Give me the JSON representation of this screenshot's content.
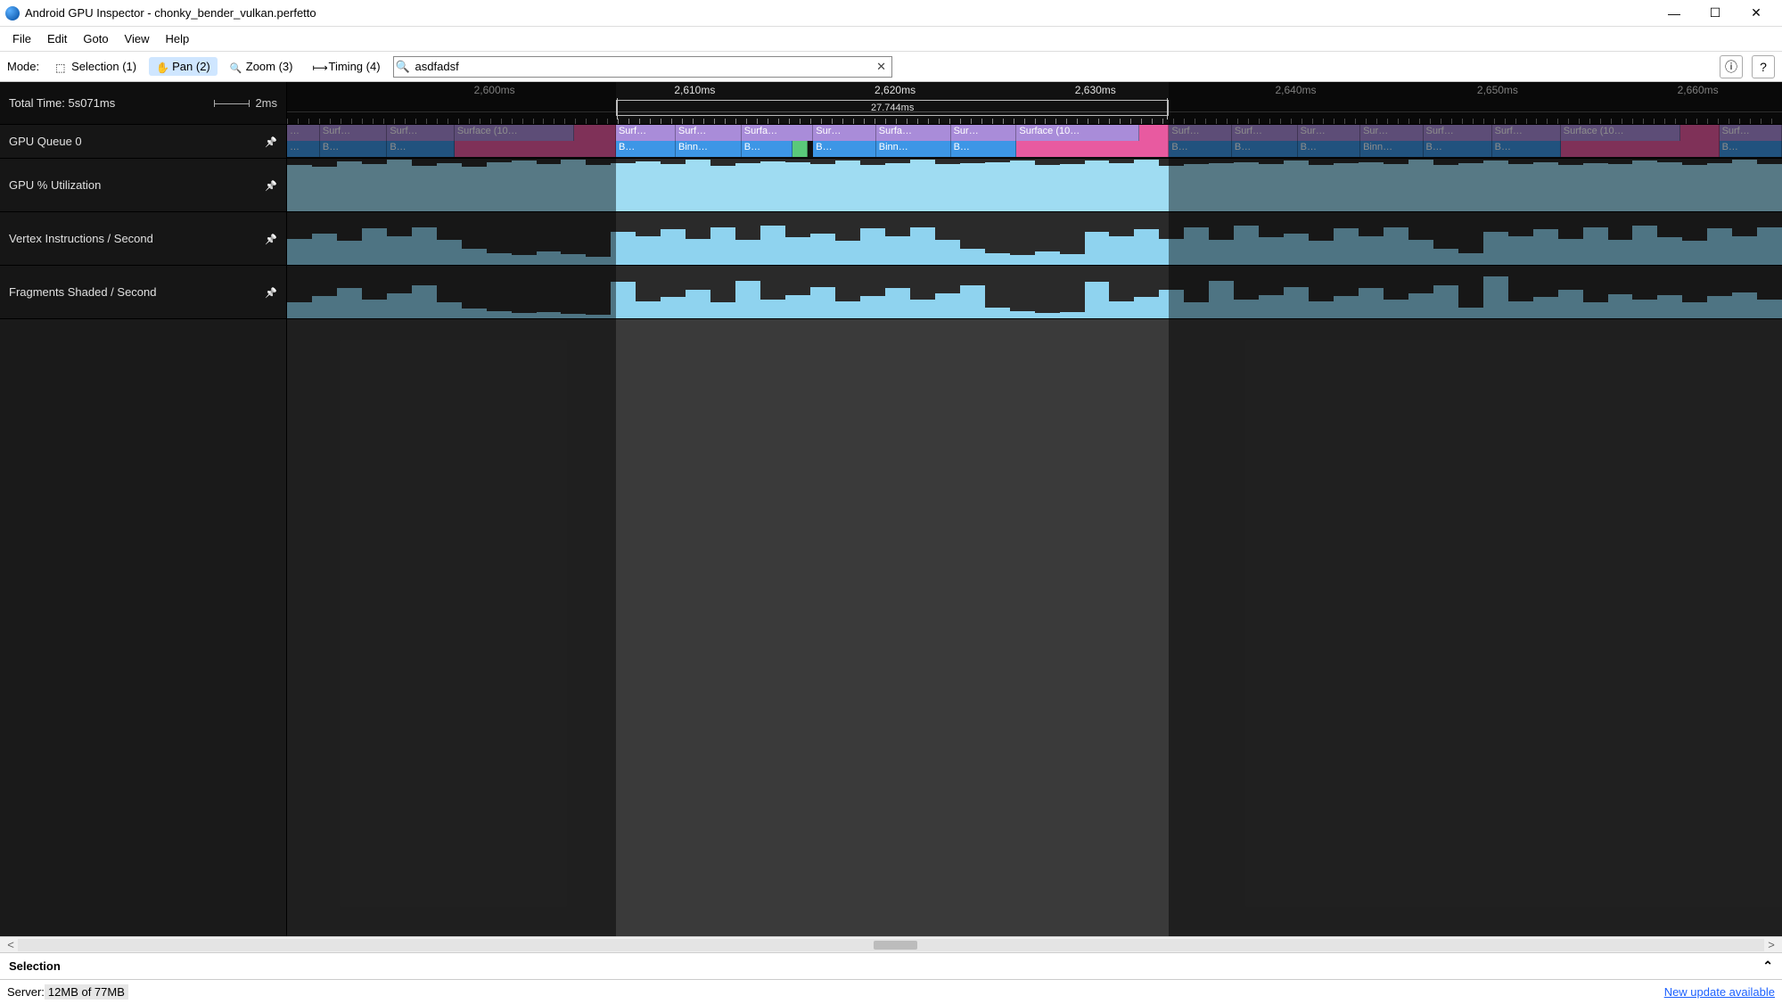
{
  "window": {
    "title": "Android GPU Inspector - chonky_bender_vulkan.perfetto"
  },
  "menu": [
    "File",
    "Edit",
    "Goto",
    "View",
    "Help"
  ],
  "toolbar": {
    "mode_label": "Mode:",
    "modes": {
      "selection": "Selection (1)",
      "pan": "Pan (2)",
      "zoom": "Zoom (3)",
      "timing": "Timing (4)"
    },
    "search_value": "asdfadsf"
  },
  "ruler": {
    "total_time": "Total Time: 5s071ms",
    "scale_label": "2ms",
    "ticks": [
      "2,600ms",
      "2,610ms",
      "2,620ms",
      "2,630ms",
      "2,640ms",
      "2,650ms",
      "2,660ms"
    ],
    "tick_positions_pct": [
      12.5,
      25.9,
      39.3,
      52.7,
      66.1,
      79.6,
      93.0
    ],
    "selection_label": "27.744ms",
    "selection_start_pct": 22.0,
    "selection_end_pct": 59.0
  },
  "tracks": {
    "gpu_queue": {
      "label": "GPU Queue 0",
      "row1": [
        {
          "l": "…",
          "c": "c-purple",
          "x": 0,
          "w": 2.2
        },
        {
          "l": "Surf…",
          "c": "c-purple",
          "x": 2.2,
          "w": 4.5
        },
        {
          "l": "Surf…",
          "c": "c-purple",
          "x": 6.7,
          "w": 4.5
        },
        {
          "l": "Surface (10…",
          "c": "c-purple",
          "x": 11.2,
          "w": 8.0
        },
        {
          "l": "",
          "c": "c-pink",
          "x": 19.2,
          "w": 2.8
        },
        {
          "l": "Surf…",
          "c": "c-purple",
          "x": 22.0,
          "w": 4.0
        },
        {
          "l": "Surf…",
          "c": "c-purple",
          "x": 26.0,
          "w": 4.4
        },
        {
          "l": "Surfa…",
          "c": "c-purple",
          "x": 30.4,
          "w": 4.8
        },
        {
          "l": "Sur…",
          "c": "c-purple",
          "x": 35.2,
          "w": 4.2
        },
        {
          "l": "Surfa…",
          "c": "c-purple",
          "x": 39.4,
          "w": 5.0
        },
        {
          "l": "Sur…",
          "c": "c-purple",
          "x": 44.4,
          "w": 4.4
        },
        {
          "l": "Surface (10…",
          "c": "c-purple",
          "x": 48.8,
          "w": 8.2
        },
        {
          "l": "",
          "c": "c-pink",
          "x": 57.0,
          "w": 2.0
        },
        {
          "l": "Surf…",
          "c": "c-purple",
          "x": 59.0,
          "w": 4.2
        },
        {
          "l": "Surf…",
          "c": "c-purple",
          "x": 63.2,
          "w": 4.4
        },
        {
          "l": "Sur…",
          "c": "c-purple",
          "x": 67.6,
          "w": 4.2
        },
        {
          "l": "Sur…",
          "c": "c-purple",
          "x": 71.8,
          "w": 4.2
        },
        {
          "l": "Surf…",
          "c": "c-purple",
          "x": 76.0,
          "w": 4.6
        },
        {
          "l": "Surf…",
          "c": "c-purple",
          "x": 80.6,
          "w": 4.6
        },
        {
          "l": "Surface (10…",
          "c": "c-purple",
          "x": 85.2,
          "w": 8.0
        },
        {
          "l": "",
          "c": "c-pink",
          "x": 93.2,
          "w": 2.6
        },
        {
          "l": "Surf…",
          "c": "c-purple",
          "x": 95.8,
          "w": 4.2
        }
      ],
      "row2": [
        {
          "l": "…",
          "c": "c-blue",
          "x": 0,
          "w": 2.2
        },
        {
          "l": "B…",
          "c": "c-blue",
          "x": 2.2,
          "w": 4.5
        },
        {
          "l": "B…",
          "c": "c-blue",
          "x": 6.7,
          "w": 4.5
        },
        {
          "l": "",
          "c": "c-pink",
          "x": 11.2,
          "w": 10.8
        },
        {
          "l": "B…",
          "c": "c-blue",
          "x": 22.0,
          "w": 4.0
        },
        {
          "l": "Binn…",
          "c": "c-blue",
          "x": 26.0,
          "w": 4.4
        },
        {
          "l": "B…",
          "c": "c-blue",
          "x": 30.4,
          "w": 3.4
        },
        {
          "l": "",
          "c": "c-green",
          "x": 33.8,
          "w": 1.0
        },
        {
          "l": "B…",
          "c": "c-blue",
          "x": 35.2,
          "w": 4.2
        },
        {
          "l": "Binn…",
          "c": "c-blue",
          "x": 39.4,
          "w": 5.0
        },
        {
          "l": "B…",
          "c": "c-blue",
          "x": 44.4,
          "w": 4.4
        },
        {
          "l": "",
          "c": "c-pink",
          "x": 48.8,
          "w": 10.2
        },
        {
          "l": "B…",
          "c": "c-blue",
          "x": 59.0,
          "w": 4.2
        },
        {
          "l": "B…",
          "c": "c-blue",
          "x": 63.2,
          "w": 4.4
        },
        {
          "l": "B…",
          "c": "c-blue",
          "x": 67.6,
          "w": 4.2
        },
        {
          "l": "Binn…",
          "c": "c-blue",
          "x": 71.8,
          "w": 4.2
        },
        {
          "l": "B…",
          "c": "c-blue",
          "x": 76.0,
          "w": 4.6
        },
        {
          "l": "B…",
          "c": "c-blue",
          "x": 80.6,
          "w": 4.6
        },
        {
          "l": "",
          "c": "c-pink",
          "x": 85.2,
          "w": 10.6
        },
        {
          "l": "B…",
          "c": "c-blue",
          "x": 95.8,
          "w": 4.2
        }
      ]
    },
    "gpu_util": {
      "label": "GPU % Utilization"
    },
    "vertex": {
      "label": "Vertex Instructions / Second"
    },
    "fragments": {
      "label": "Fragments Shaded / Second"
    }
  },
  "chart_data": [
    {
      "type": "bar",
      "title": "GPU % Utilization",
      "ylim": [
        0,
        100
      ],
      "values": [
        88,
        85,
        95,
        90,
        98,
        86,
        92,
        84,
        94,
        96,
        90,
        99,
        88,
        92,
        95,
        90,
        98,
        86,
        92,
        95,
        94,
        90,
        96,
        88,
        92,
        98,
        90,
        92,
        94,
        96,
        88,
        90,
        96,
        92,
        98,
        86,
        90,
        92,
        94,
        90,
        96,
        88,
        92,
        94,
        90,
        98,
        88,
        92,
        96,
        90,
        94,
        88,
        92,
        90,
        96,
        94,
        88,
        92,
        98,
        90
      ]
    },
    {
      "type": "bar",
      "title": "Vertex Instructions / Second",
      "ylim": [
        0,
        100
      ],
      "values": [
        50,
        60,
        45,
        70,
        55,
        72,
        48,
        30,
        22,
        18,
        25,
        20,
        15,
        62,
        55,
        68,
        50,
        72,
        48,
        74,
        52,
        60,
        46,
        70,
        55,
        72,
        48,
        30,
        22,
        18,
        25,
        20,
        62,
        55,
        68,
        50,
        72,
        48,
        74,
        52,
        60,
        46,
        70,
        55,
        72,
        48,
        30,
        22,
        62,
        55,
        68,
        50,
        72,
        48,
        74,
        52,
        46,
        70,
        55,
        72
      ]
    },
    {
      "type": "bar",
      "title": "Fragments Shaded / Second",
      "ylim": [
        0,
        100
      ],
      "values": [
        30,
        42,
        58,
        35,
        48,
        62,
        30,
        18,
        14,
        10,
        12,
        8,
        6,
        70,
        32,
        40,
        55,
        30,
        72,
        35,
        44,
        60,
        32,
        42,
        58,
        35,
        48,
        62,
        20,
        14,
        10,
        12,
        70,
        32,
        40,
        55,
        30,
        72,
        35,
        44,
        60,
        32,
        42,
        58,
        35,
        48,
        62,
        20,
        80,
        32,
        40,
        55,
        30,
        45,
        35,
        44,
        30,
        42,
        50,
        35
      ]
    }
  ],
  "selection_panel": {
    "title": "Selection"
  },
  "status": {
    "server_label": "Server: ",
    "memory": "12MB of 77MB",
    "update": "New update available"
  }
}
